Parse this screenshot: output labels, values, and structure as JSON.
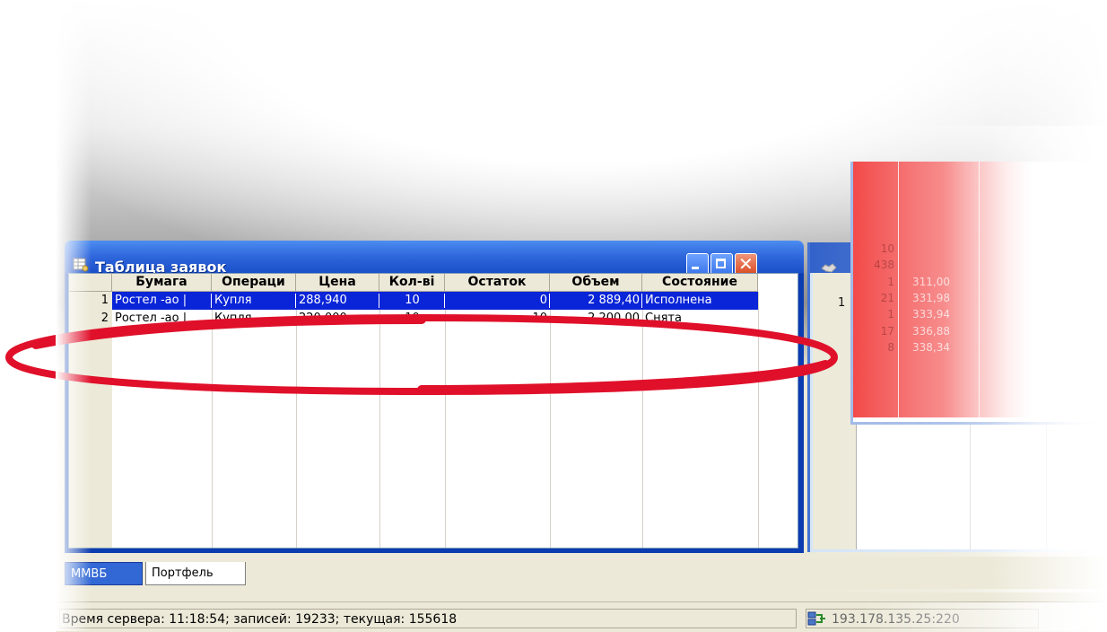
{
  "window": {
    "title": "Таблица заявок",
    "buttons": {
      "minimize": "minimize",
      "maximize": "maximize",
      "close": "close"
    }
  },
  "table": {
    "columns": [
      "Бумага",
      "Операци",
      "Цена",
      "Кол-ві",
      "Остаток",
      "Объем",
      "Состояние"
    ],
    "rows": [
      {
        "num": "1",
        "security": "Ростел -ао |",
        "operation": "Купля",
        "price": "288,940",
        "qty": "10",
        "rest": "0",
        "volume": "2 889,40",
        "state": "Исполнена"
      },
      {
        "num": "2",
        "security": "Ростел -ао |",
        "operation": "Купля",
        "price": "220,000",
        "qty": "10",
        "rest": "10",
        "volume": "2 200,00",
        "state": "Снята"
      }
    ],
    "selected_row": 1
  },
  "orderbook": {
    "row_header": "1",
    "qty": [
      "10",
      "438",
      "1",
      "21",
      "1",
      "17",
      "8"
    ],
    "prices": [
      "",
      "",
      "311,00",
      "331,98",
      "333,94",
      "336,88",
      "338,34"
    ]
  },
  "tabs": {
    "active": "ММВБ",
    "other": "Портфель"
  },
  "status": {
    "server": "Время сервера: 11:18:54; записей: 19233; текущая: 155618",
    "connection": "193.178.135.25:220"
  },
  "colors": {
    "title_bar": "#2e66dc",
    "selection": "#0a24d8",
    "annotation": "#e0102a",
    "orderbook_red": "#f23a3a"
  },
  "icons": {
    "window": "table-window-icon",
    "network": "network-icon",
    "second_window": "handshake-icon"
  }
}
